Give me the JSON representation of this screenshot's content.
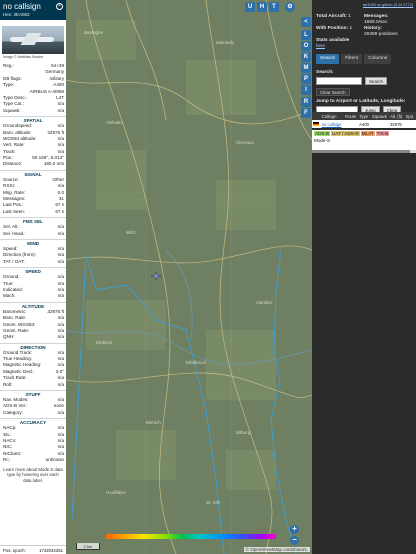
{
  "info": {
    "callsign": "no callsign",
    "hex": "Hex: 3EA063",
    "photo_credit": "Image © Matthias Becker",
    "rows_top": [
      {
        "k": "Reg.:",
        "v": "54+39"
      },
      {
        "k": "",
        "v": "Germany"
      },
      {
        "k": "DB flags:",
        "v": "military"
      },
      {
        "k": "Type:",
        "v": "A400"
      },
      {
        "k": "",
        "v": "AIRBUS A-400M"
      },
      {
        "k": "Type Desc.:",
        "v": "L4T"
      },
      {
        "k": "Type Cat.:",
        "v": "n/a"
      },
      {
        "k": "Squawk:",
        "v": "n/a"
      }
    ],
    "spatial_title": "SPATIAL",
    "spatial": [
      {
        "k": "Groundspeed:",
        "v": "n/a"
      },
      {
        "k": "Baro. altitude:",
        "v": "32975 ft"
      },
      {
        "k": "WGS84 altitude:",
        "v": "n/a"
      },
      {
        "k": "Vert. Rate:",
        "v": "n/a"
      },
      {
        "k": "Track:",
        "v": "n/a"
      },
      {
        "k": "Pos.:",
        "v": "50.169°, 6.013°"
      },
      {
        "k": "Distance:",
        "v": "180.0 nmi"
      }
    ],
    "signal_title": "SIGNAL",
    "signal": [
      {
        "k": "Source:",
        "v": "Other"
      },
      {
        "k": "RSSI:",
        "v": "n/a"
      },
      {
        "k": "Msg. Rate:",
        "v": "0.0"
      },
      {
        "k": "Messages:",
        "v": "31"
      },
      {
        "k": "Last Pos.:",
        "v": "67 s"
      },
      {
        "k": "Last Seen:",
        "v": "67 s"
      }
    ],
    "fms_title": "FMS SEL",
    "fms": [
      {
        "k": "Sel. Alt.:",
        "v": "n/a"
      },
      {
        "k": "Sel. Head.:",
        "v": "n/a"
      }
    ],
    "wind_title": "WIND",
    "wind": [
      {
        "k": "Speed:",
        "v": "n/a"
      },
      {
        "k": "Direction (from):",
        "v": "n/a"
      },
      {
        "k": "TAT / OAT:",
        "v": "n/a"
      }
    ],
    "speed_title": "SPEED",
    "speed": [
      {
        "k": "Ground:",
        "v": "n/a"
      },
      {
        "k": "True:",
        "v": "n/a"
      },
      {
        "k": "Indicated:",
        "v": "n/a"
      },
      {
        "k": "Mach:",
        "v": "n/a"
      }
    ],
    "altitude_title": "ALTITUDE",
    "altitude": [
      {
        "k": "Barometric:",
        "v": "32975 ft"
      },
      {
        "k": "Baro. Rate:",
        "v": "n/a"
      },
      {
        "k": "Geom. WGS84:",
        "v": "n/a"
      },
      {
        "k": "Geom. Rate:",
        "v": "n/a"
      },
      {
        "k": "QNH:",
        "v": "n/a"
      }
    ],
    "direction_title": "DIRECTION",
    "direction": [
      {
        "k": "Ground Track:",
        "v": "n/a"
      },
      {
        "k": "True Heading:",
        "v": "n/a"
      },
      {
        "k": "Magnetic Heading:",
        "v": "n/a"
      },
      {
        "k": "Magnetic Decl.:",
        "v": "3.0°"
      },
      {
        "k": "Track Rate:",
        "v": "n/a"
      },
      {
        "k": "Roll:",
        "v": "n/a"
      }
    ],
    "stuff_title": "STUFF",
    "stuff": [
      {
        "k": "Nav. Modes:",
        "v": "n/a"
      },
      {
        "k": "ADS-B Ver.:",
        "v": "none"
      },
      {
        "k": "Category:",
        "v": "n/a"
      }
    ],
    "accuracy_title": "ACCURACY",
    "accuracy": [
      {
        "k": "NACp:",
        "v": "n/a"
      },
      {
        "k": "SIL:",
        "v": "n/a"
      },
      {
        "k": "NACv:",
        "v": "n/a"
      },
      {
        "k": "NIC:",
        "v": "n/a"
      },
      {
        "k": "NICbaro:",
        "v": "n/a"
      },
      {
        "k": "Rc:",
        "v": "unknown"
      }
    ],
    "learn_more": "Learn more about Mode S data type by hovering over each data label.",
    "footer_label": "Pos. epoch:",
    "footer_value": "1742034251"
  },
  "map": {
    "buttons_top": [
      "U",
      "H",
      "T"
    ],
    "zoom_in": "+",
    "zoom_out": "−",
    "scale": "2 km",
    "attribution": "© OpenStreetMap contributors.",
    "colorbar_labels": [
      "",
      "",
      "",
      "",
      "",
      "",
      "",
      "",
      "",
      ""
    ],
    "places": [
      "Bastogne",
      "Malmedy",
      "Vielsalm",
      "Clervaux",
      "Wiltz",
      "Vianden",
      "Diekirch",
      "Ettelbruck",
      "Mersch",
      "Bitburg",
      "Houffalize",
      "St. Vith"
    ],
    "colors": {
      "map_bg": "#6f7f62",
      "road": "#d9c98a",
      "border": "#3aa0d8",
      "water": "#6a9ab8"
    }
  },
  "rnav": [
    "<",
    "L",
    "O",
    "K",
    "M",
    "P",
    "I",
    "R",
    "F"
  ],
  "side": {
    "version": "tar1090 on github (3.14.1772)",
    "stats": [
      {
        "k": "Total Aircraft:",
        "v": "1"
      },
      {
        "k": "Messages:",
        "v": "1669.0/sec"
      },
      {
        "k": "With Position:",
        "v": "1"
      },
      {
        "k": "History:",
        "v": "26399 positions"
      }
    ],
    "stats_label": "Stats available",
    "stats_link": "here",
    "tabs": [
      "Search",
      "Filters",
      "Columns"
    ],
    "search_label": "Search:",
    "search_btn": "Search",
    "clear_search": "Clear Search",
    "jump_label": "Jump to Airport or Latitude, Longitude:",
    "jump_btn": "Jump",
    "clear_btn": "Clear",
    "table_headers": [
      "",
      "Callsign",
      "Route",
      "Type",
      "Squawk",
      "Alt. (ft)",
      "Spd."
    ],
    "table_row": {
      "callsign": "no callsign",
      "type": "A400",
      "alt": "32975"
    },
    "legend": [
      "ADS-B",
      "UAT / ADS-R",
      "MLAT",
      "TIS-B"
    ],
    "modes": "Mode-S"
  }
}
